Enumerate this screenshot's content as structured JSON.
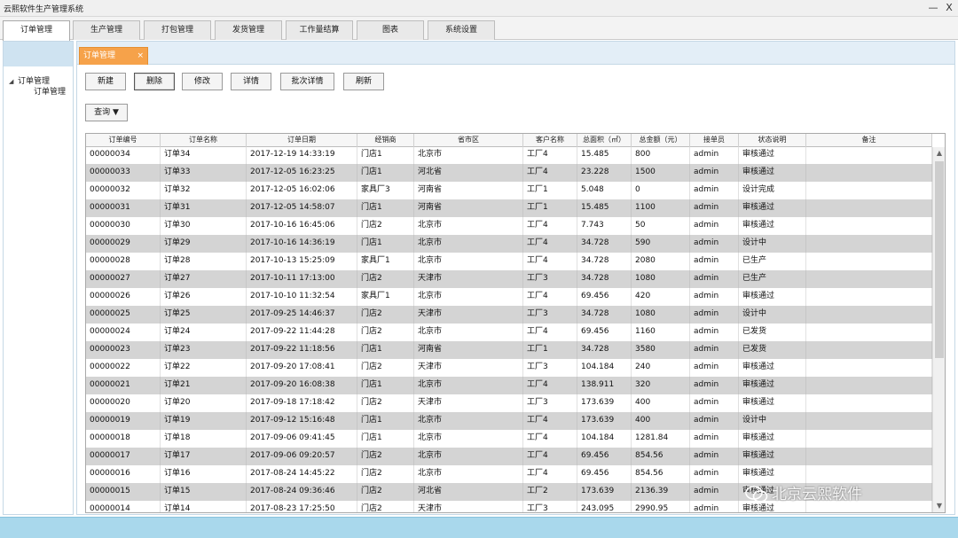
{
  "window": {
    "title": "云熙软件生产管理系统",
    "min_glyph": "—",
    "close_glyph": "X"
  },
  "main_tabs": [
    {
      "label": "订单管理",
      "active": true
    },
    {
      "label": "生产管理"
    },
    {
      "label": "打包管理"
    },
    {
      "label": "发货管理"
    },
    {
      "label": "工作量结算"
    },
    {
      "label": "图表"
    },
    {
      "label": "系统设置"
    }
  ],
  "tree": {
    "root_label": "订单管理",
    "child_label": "订单管理"
  },
  "doc_tab": {
    "label": "订单管理",
    "close_glyph": "×"
  },
  "toolbar": {
    "new_label": "新建",
    "delete_label": "删除",
    "edit_label": "修改",
    "detail_label": "详情",
    "batch_detail_label": "批次详情",
    "refresh_label": "刷新"
  },
  "query": {
    "label": "查询 ▼"
  },
  "grid": {
    "columns": [
      "订单编号",
      "订单名称",
      "订单日期",
      "经销商",
      "省市区",
      "客户名称",
      "总面积（㎡）",
      "总金额（元）",
      "接单员",
      "状态说明",
      "备注"
    ],
    "rows": [
      [
        "00000034",
        "订单34",
        "2017-12-19 14:33:19",
        "门店1",
        "北京市",
        "工厂4",
        "15.485",
        "800",
        "admin",
        "审核通过",
        ""
      ],
      [
        "00000033",
        "订单33",
        "2017-12-05 16:23:25",
        "门店1",
        "河北省",
        "工厂4",
        "23.228",
        "1500",
        "admin",
        "审核通过",
        ""
      ],
      [
        "00000032",
        "订单32",
        "2017-12-05 16:02:06",
        "家具厂3",
        "河南省",
        "工厂1",
        "5.048",
        "0",
        "admin",
        "设计完成",
        ""
      ],
      [
        "00000031",
        "订单31",
        "2017-12-05 14:58:07",
        "门店1",
        "河南省",
        "工厂1",
        "15.485",
        "1100",
        "admin",
        "审核通过",
        ""
      ],
      [
        "00000030",
        "订单30",
        "2017-10-16 16:45:06",
        "门店2",
        "北京市",
        "工厂4",
        "7.743",
        "50",
        "admin",
        "审核通过",
        ""
      ],
      [
        "00000029",
        "订单29",
        "2017-10-16 14:36:19",
        "门店1",
        "北京市",
        "工厂4",
        "34.728",
        "590",
        "admin",
        "设计中",
        ""
      ],
      [
        "00000028",
        "订单28",
        "2017-10-13 15:25:09",
        "家具厂1",
        "北京市",
        "工厂4",
        "34.728",
        "2080",
        "admin",
        "已生产",
        ""
      ],
      [
        "00000027",
        "订单27",
        "2017-10-11 17:13:00",
        "门店2",
        "天津市",
        "工厂3",
        "34.728",
        "1080",
        "admin",
        "已生产",
        ""
      ],
      [
        "00000026",
        "订单26",
        "2017-10-10 11:32:54",
        "家具厂1",
        "北京市",
        "工厂4",
        "69.456",
        "420",
        "admin",
        "审核通过",
        ""
      ],
      [
        "00000025",
        "订单25",
        "2017-09-25 14:46:37",
        "门店2",
        "天津市",
        "工厂3",
        "34.728",
        "1080",
        "admin",
        "设计中",
        ""
      ],
      [
        "00000024",
        "订单24",
        "2017-09-22 11:44:28",
        "门店2",
        "北京市",
        "工厂4",
        "69.456",
        "1160",
        "admin",
        "已发货",
        ""
      ],
      [
        "00000023",
        "订单23",
        "2017-09-22 11:18:56",
        "门店1",
        "河南省",
        "工厂1",
        "34.728",
        "3580",
        "admin",
        "已发货",
        ""
      ],
      [
        "00000022",
        "订单22",
        "2017-09-20 17:08:41",
        "门店2",
        "天津市",
        "工厂3",
        "104.184",
        "240",
        "admin",
        "审核通过",
        ""
      ],
      [
        "00000021",
        "订单21",
        "2017-09-20 16:08:38",
        "门店1",
        "北京市",
        "工厂4",
        "138.911",
        "320",
        "admin",
        "审核通过",
        ""
      ],
      [
        "00000020",
        "订单20",
        "2017-09-18 17:18:42",
        "门店2",
        "天津市",
        "工厂3",
        "173.639",
        "400",
        "admin",
        "审核通过",
        ""
      ],
      [
        "00000019",
        "订单19",
        "2017-09-12 15:16:48",
        "门店1",
        "北京市",
        "工厂4",
        "173.639",
        "400",
        "admin",
        "设计中",
        ""
      ],
      [
        "00000018",
        "订单18",
        "2017-09-06 09:41:45",
        "门店1",
        "北京市",
        "工厂4",
        "104.184",
        "1281.84",
        "admin",
        "审核通过",
        ""
      ],
      [
        "00000017",
        "订单17",
        "2017-09-06 09:20:57",
        "门店2",
        "北京市",
        "工厂4",
        "69.456",
        "854.56",
        "admin",
        "审核通过",
        ""
      ],
      [
        "00000016",
        "订单16",
        "2017-08-24 14:45:22",
        "门店2",
        "北京市",
        "工厂4",
        "69.456",
        "854.56",
        "admin",
        "审核通过",
        ""
      ],
      [
        "00000015",
        "订单15",
        "2017-08-24 09:36:46",
        "门店2",
        "河北省",
        "工厂2",
        "173.639",
        "2136.39",
        "admin",
        "审核通过",
        ""
      ],
      [
        "00000014",
        "订单14",
        "2017-08-23 17:25:50",
        "门店2",
        "天津市",
        "工厂3",
        "243.095",
        "2990.95",
        "admin",
        "审核通过",
        ""
      ]
    ]
  },
  "watermark": {
    "text": "北京云熙软件"
  },
  "colors": {
    "row_alt": "#d4d4d4",
    "doc_tab": "#f6a24a",
    "status_bar": "#a9d8ec",
    "panel_border": "#c5d8e6"
  }
}
